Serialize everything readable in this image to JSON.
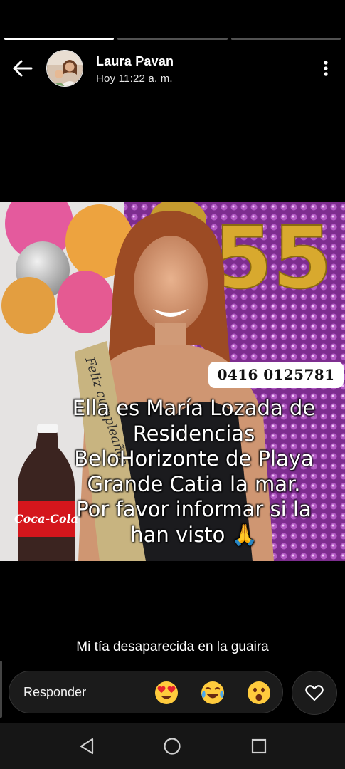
{
  "story": {
    "progress": [
      1,
      0,
      0
    ],
    "colors": {
      "bar_active": "#ffffff",
      "bar_inactive": "#5a5a5a"
    }
  },
  "header": {
    "back_icon": "arrow-left-icon",
    "user_name": "Laura Pavan",
    "timestamp": "Hoy 11:22 a. m.",
    "more_icon": "more-vertical-icon"
  },
  "post": {
    "phone_number": "0416 0125781",
    "overlay_lines": [
      "Ella es María Lozada de",
      "Residencias",
      "BeloHorizonte de Playa",
      "Grande Catia la mar.",
      "Por favor informar si la",
      "han visto 🙏"
    ],
    "sash_text": "Feliz cumpleaños",
    "bottle_label": "Coca-Cola",
    "balloon_number": "55",
    "caption": "Mi tía desaparecida en la guaira"
  },
  "reply": {
    "placeholder": "Responder",
    "reactions": [
      "heart-eyes-emoji",
      "tears-of-joy-emoji",
      "surprised-emoji"
    ],
    "like_icon": "heart-icon"
  },
  "navbar": {
    "buttons": [
      "back-triangle-icon",
      "home-circle-icon",
      "recents-square-icon"
    ]
  }
}
